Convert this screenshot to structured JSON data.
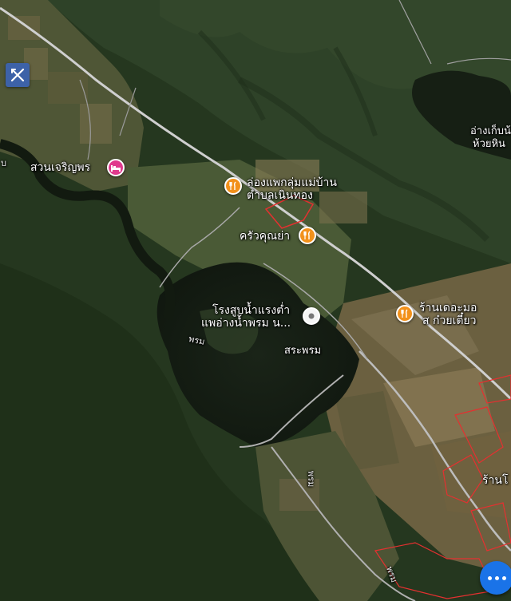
{
  "map": {
    "type": "satellite",
    "colors": {
      "forest": "#25371f",
      "field": "#6b6040",
      "water": "#141c12",
      "road": "#bfbfbf",
      "boundary": "#e53030"
    }
  },
  "controls": {
    "layers_button_icon": "crossed-tools-icon",
    "more_button_icon": "more-dots-icon"
  },
  "places": [
    {
      "id": "suan-charoenporn",
      "label": "สวนเจริญพร",
      "category": "hotel",
      "icon": "bed-icon"
    },
    {
      "id": "raft-group",
      "label_line1": "ล่องแพกลุ่มแม่บ้าน",
      "label_line2": "ตำบลเนินทอง",
      "category": "restaurant",
      "icon": "utensils-icon"
    },
    {
      "id": "krua-khun-ya",
      "label": "ครัวคุณย่า",
      "category": "restaurant",
      "icon": "utensils-icon"
    },
    {
      "id": "power-plant",
      "label_line1": "โรงสูบน้ำแรงต่ำ",
      "label_line2": "แพอ่างน้ำพรม น...",
      "category": "place",
      "icon": "location-dot-icon"
    },
    {
      "id": "der-a-mor",
      "label_line1": "ร้านเดอะมอ",
      "label_line2": "ส ก๋วยเตี๋ยว",
      "category": "restaurant",
      "icon": "utensils-icon"
    }
  ],
  "area_labels": {
    "reservoir_line1": "อ่างเก็บน้",
    "reservoir_line2": "ห้วยหิน",
    "lake": "สระพรม",
    "water_prom": "พรม",
    "road_label_1": "พรม",
    "road_label_2": "พรม",
    "shop_edge": "ร้านโ",
    "left_edge": "บ"
  }
}
